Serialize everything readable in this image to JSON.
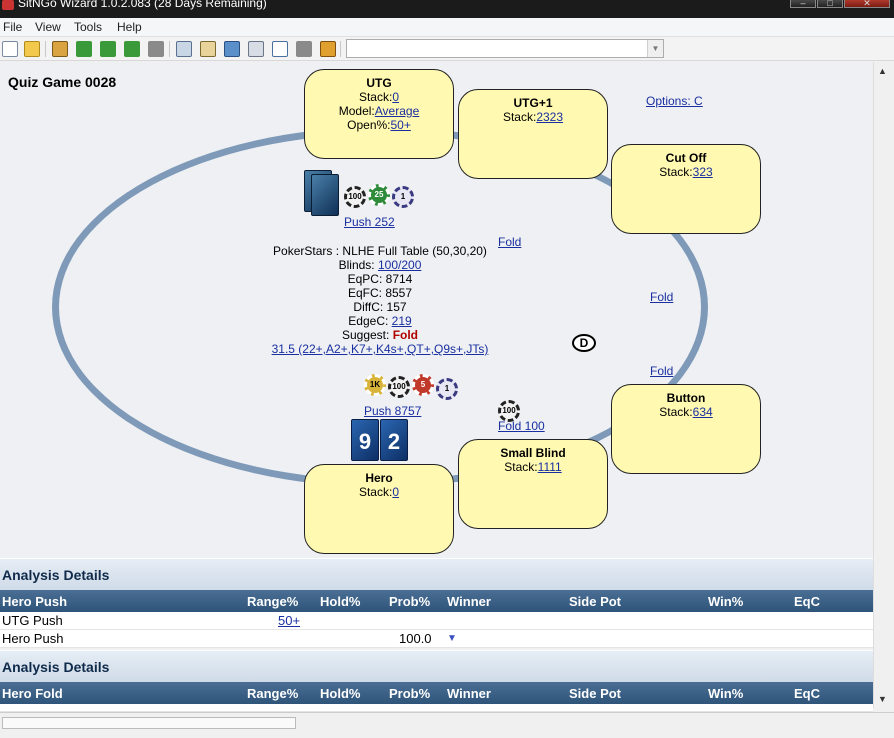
{
  "window": {
    "title": "SitNGo Wizard 1.0.2.083 (28 Days Remaining)"
  },
  "menu": [
    "File",
    "View",
    "Tools",
    "Help"
  ],
  "toolbar_icons": [
    "new-file-icon",
    "open-folder-icon",
    "home-icon",
    "up-arrow-icon",
    "back-arrow-icon",
    "forward-arrow-icon",
    "stop-icon",
    "copy-icon",
    "paste-icon",
    "image-icon",
    "calculator-icon",
    "chart-icon",
    "tag-icon",
    "settings-icon"
  ],
  "quiz_title": "Quiz Game 0028",
  "options_link": "Options: C",
  "seats": {
    "utg": {
      "name": "UTG",
      "stack_label": "Stack:",
      "stack": "0",
      "model_label": "Model:",
      "model": "Average",
      "open_label": "Open%:",
      "open": "50+"
    },
    "utg1": {
      "name": "UTG+1",
      "stack_label": "Stack:",
      "stack": "2323"
    },
    "cutoff": {
      "name": "Cut Off",
      "stack_label": "Stack:",
      "stack": "323"
    },
    "button": {
      "name": "Button",
      "stack_label": "Stack:",
      "stack": "634"
    },
    "small_blind": {
      "name": "Small Blind",
      "stack_label": "Stack:",
      "stack": "1111"
    },
    "hero": {
      "name": "Hero",
      "stack_label": "Stack:",
      "stack": "0"
    }
  },
  "actions": {
    "utg": "Push 252",
    "utg1": "Fold",
    "cutoff": "Fold",
    "button": "Fold",
    "small_blind": "Fold 100",
    "hero": "Push 8757"
  },
  "chips": {
    "utg": [
      "100",
      "25",
      "1"
    ],
    "hero": [
      "1K",
      "100",
      "5",
      "1"
    ],
    "small_blind": [
      "100"
    ]
  },
  "hero_cards": [
    "9",
    "2"
  ],
  "dealer_button": "D",
  "center_info": {
    "site": "PokerStars : NLHE Full Table (50,30,20)",
    "blinds_label": "Blinds:",
    "blinds": "100/200",
    "eqpc_label": "EqPC:",
    "eqpc": "8714",
    "eqfc_label": "EqFC:",
    "eqfc": "8557",
    "diffc_label": "DiffC:",
    "diffc": "157",
    "edgec_label": "EdgeC:",
    "edgec": "219",
    "suggest_label": "Suggest:",
    "suggest": "Fold",
    "range": "31.5 (22+,A2+,K7+,K4s+,QT+,Q9s+,JTs)"
  },
  "analysis": [
    {
      "title": "Analysis Details",
      "columns": [
        "Hero Push",
        "Range%",
        "Hold%",
        "Prob%",
        "Winner",
        "Side Pot",
        "Win%",
        "EqC"
      ],
      "rows": [
        {
          "label": "UTG Push",
          "range": "50+",
          "prob": ""
        },
        {
          "label": "Hero Push",
          "range": "",
          "prob": "100.0"
        }
      ]
    },
    {
      "title": "Analysis Details",
      "columns": [
        "Hero Fold",
        "Range%",
        "Hold%",
        "Prob%",
        "Winner",
        "Side Pot",
        "Win%",
        "EqC"
      ]
    }
  ],
  "colors": {
    "seat_fill": "#fff9b2",
    "table_rail": "#7e9ab8",
    "link": "#1a2fa0",
    "suggest": "#b00000",
    "header": "#3b5f85"
  }
}
